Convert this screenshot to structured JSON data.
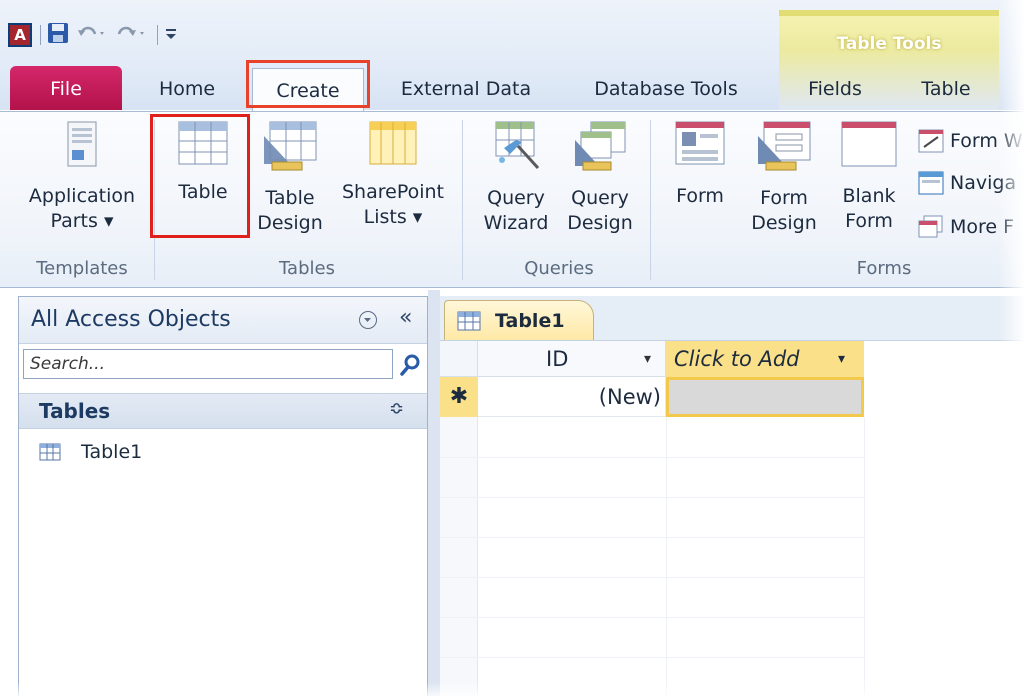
{
  "quick_access": {
    "logo_letter": "A",
    "icons": [
      "access-logo-icon",
      "save-icon",
      "undo-icon",
      "redo-icon",
      "customize-qat-icon"
    ]
  },
  "contextual": {
    "label": "Table Tools"
  },
  "tabs": {
    "file": "File",
    "home": "Home",
    "create": "Create",
    "external_data": "External Data",
    "database_tools": "Database Tools",
    "fields": "Fields",
    "table": "Table"
  },
  "ribbon": {
    "templates": {
      "label": "Templates",
      "application_parts": "Application\nParts ▾"
    },
    "tables": {
      "label": "Tables",
      "table": "Table",
      "table_design": "Table\nDesign",
      "sharepoint_lists": "SharePoint\nLists ▾"
    },
    "queries": {
      "label": "Queries",
      "query_wizard": "Query\nWizard",
      "query_design": "Query\nDesign"
    },
    "forms": {
      "label": "Forms",
      "form": "Form",
      "form_design": "Form\nDesign",
      "blank_form": "Blank\nForm",
      "form_wizard": "Form W",
      "navigation": "Naviga",
      "more_forms": "More F"
    }
  },
  "nav_pane": {
    "title": "All Access Objects",
    "collapse_glyph": "«",
    "search_placeholder": "Search...",
    "group_title": "Tables",
    "group_chevron": "≎",
    "items": [
      {
        "label": "Table1"
      }
    ]
  },
  "document": {
    "tab_label": "Table1",
    "columns": [
      {
        "label": "ID",
        "arrow": "▾"
      },
      {
        "label": "Click to Add",
        "arrow": "▾"
      }
    ],
    "new_row": {
      "selector": "✱",
      "id_value": "(New)"
    }
  },
  "colors": {
    "file_tab": "#c21a5b",
    "highlight_box": "#e8412c",
    "contextual": "#ecea9f",
    "column_header_active": "#fbe08a"
  }
}
